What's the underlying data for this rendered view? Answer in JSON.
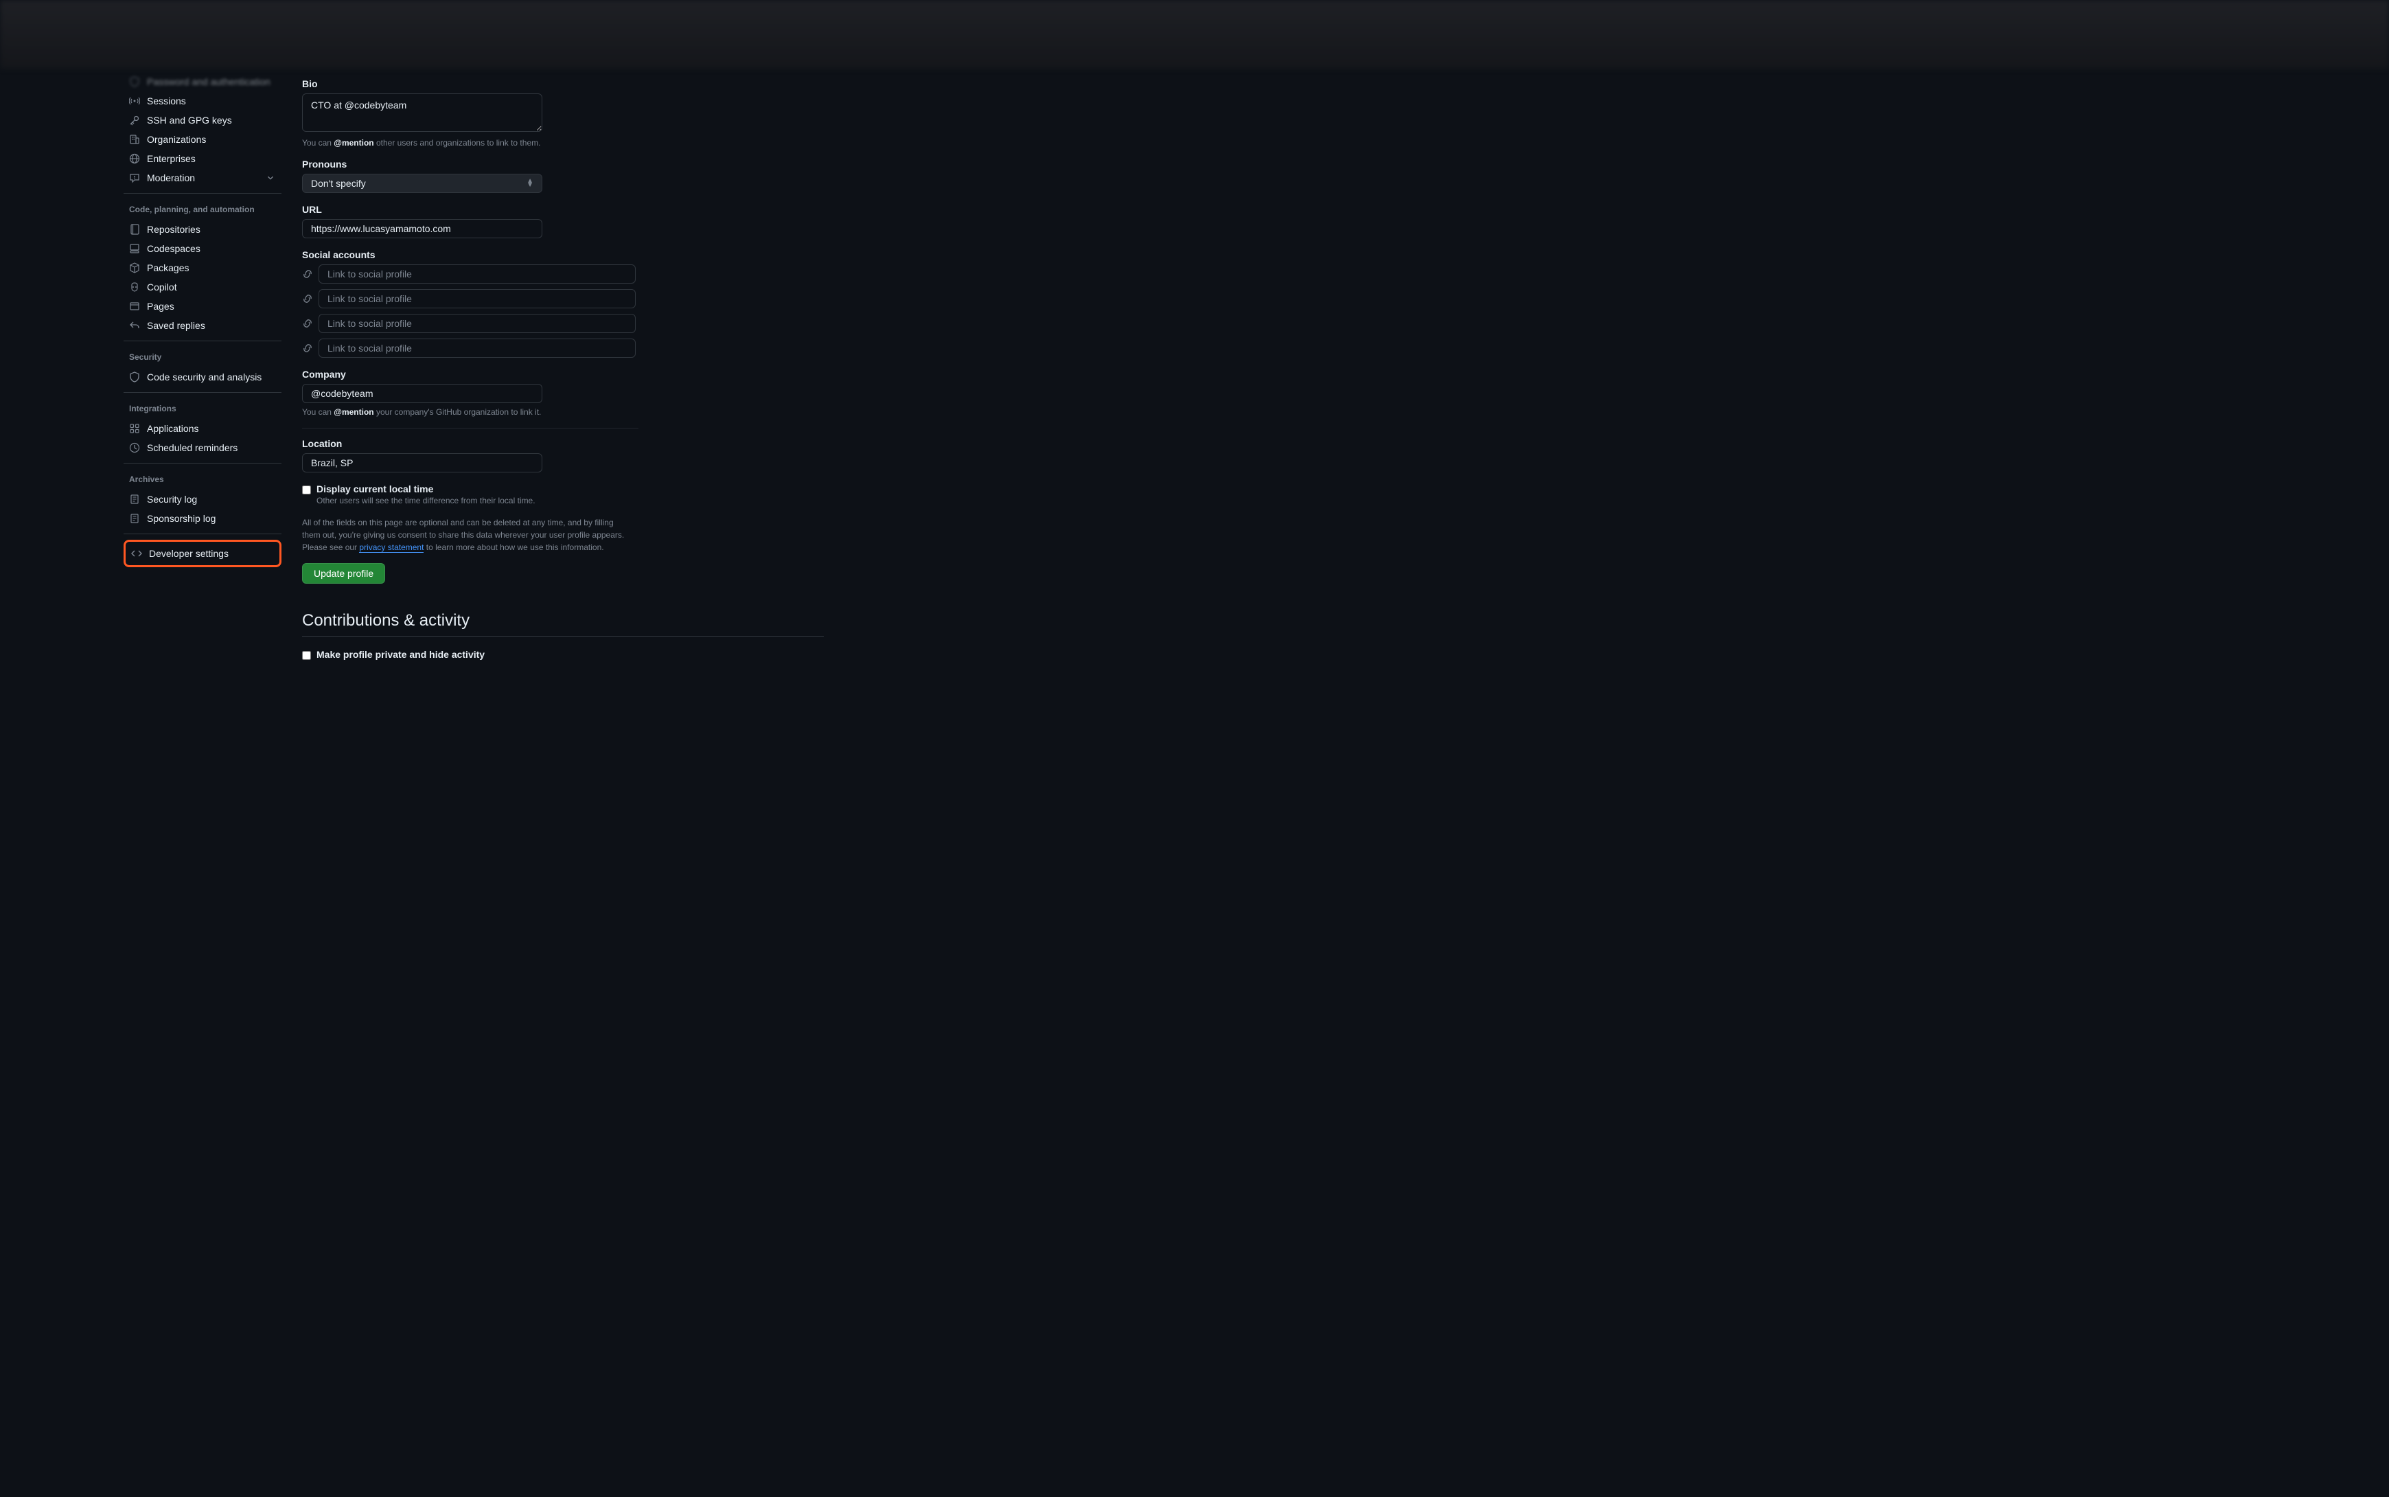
{
  "sidebar": {
    "truncated_item": "Password and authentication",
    "access_items": [
      {
        "label": "Sessions"
      },
      {
        "label": "SSH and GPG keys"
      },
      {
        "label": "Organizations"
      },
      {
        "label": "Enterprises"
      },
      {
        "label": "Moderation"
      }
    ],
    "section_code": "Code, planning, and automation",
    "code_items": [
      {
        "label": "Repositories"
      },
      {
        "label": "Codespaces"
      },
      {
        "label": "Packages"
      },
      {
        "label": "Copilot"
      },
      {
        "label": "Pages"
      },
      {
        "label": "Saved replies"
      }
    ],
    "section_security": "Security",
    "security_items": [
      {
        "label": "Code security and analysis"
      }
    ],
    "section_integrations": "Integrations",
    "integrations_items": [
      {
        "label": "Applications"
      },
      {
        "label": "Scheduled reminders"
      }
    ],
    "section_archives": "Archives",
    "archives_items": [
      {
        "label": "Security log"
      },
      {
        "label": "Sponsorship log"
      }
    ],
    "developer_settings": "Developer settings"
  },
  "form": {
    "bio": {
      "label": "Bio",
      "value": "CTO at @codebyteam",
      "hint_prefix": "You can ",
      "hint_mention": "@mention",
      "hint_suffix": " other users and organizations to link to them."
    },
    "pronouns": {
      "label": "Pronouns",
      "value": "Don't specify"
    },
    "url": {
      "label": "URL",
      "value": "https://www.lucasyamamoto.com"
    },
    "social": {
      "label": "Social accounts",
      "placeholder": "Link to social profile"
    },
    "company": {
      "label": "Company",
      "value": "@codebyteam",
      "hint_prefix": "You can ",
      "hint_mention": "@mention",
      "hint_suffix": " your company's GitHub organization to link it."
    },
    "location": {
      "label": "Location",
      "value": "Brazil, SP"
    },
    "localtime": {
      "label": "Display current local time",
      "sublabel": "Other users will see the time difference from their local time."
    },
    "info": {
      "text1": "All of the fields on this page are optional and can be deleted at any time, and by filling them out, you're giving us consent to share this data wherever your user profile appears. Please see our ",
      "link": "privacy statement",
      "text2": " to learn more about how we use this information."
    },
    "submit": "Update profile"
  },
  "contributions": {
    "heading": "Contributions & activity",
    "private_checkbox": "Make profile private and hide activity"
  }
}
